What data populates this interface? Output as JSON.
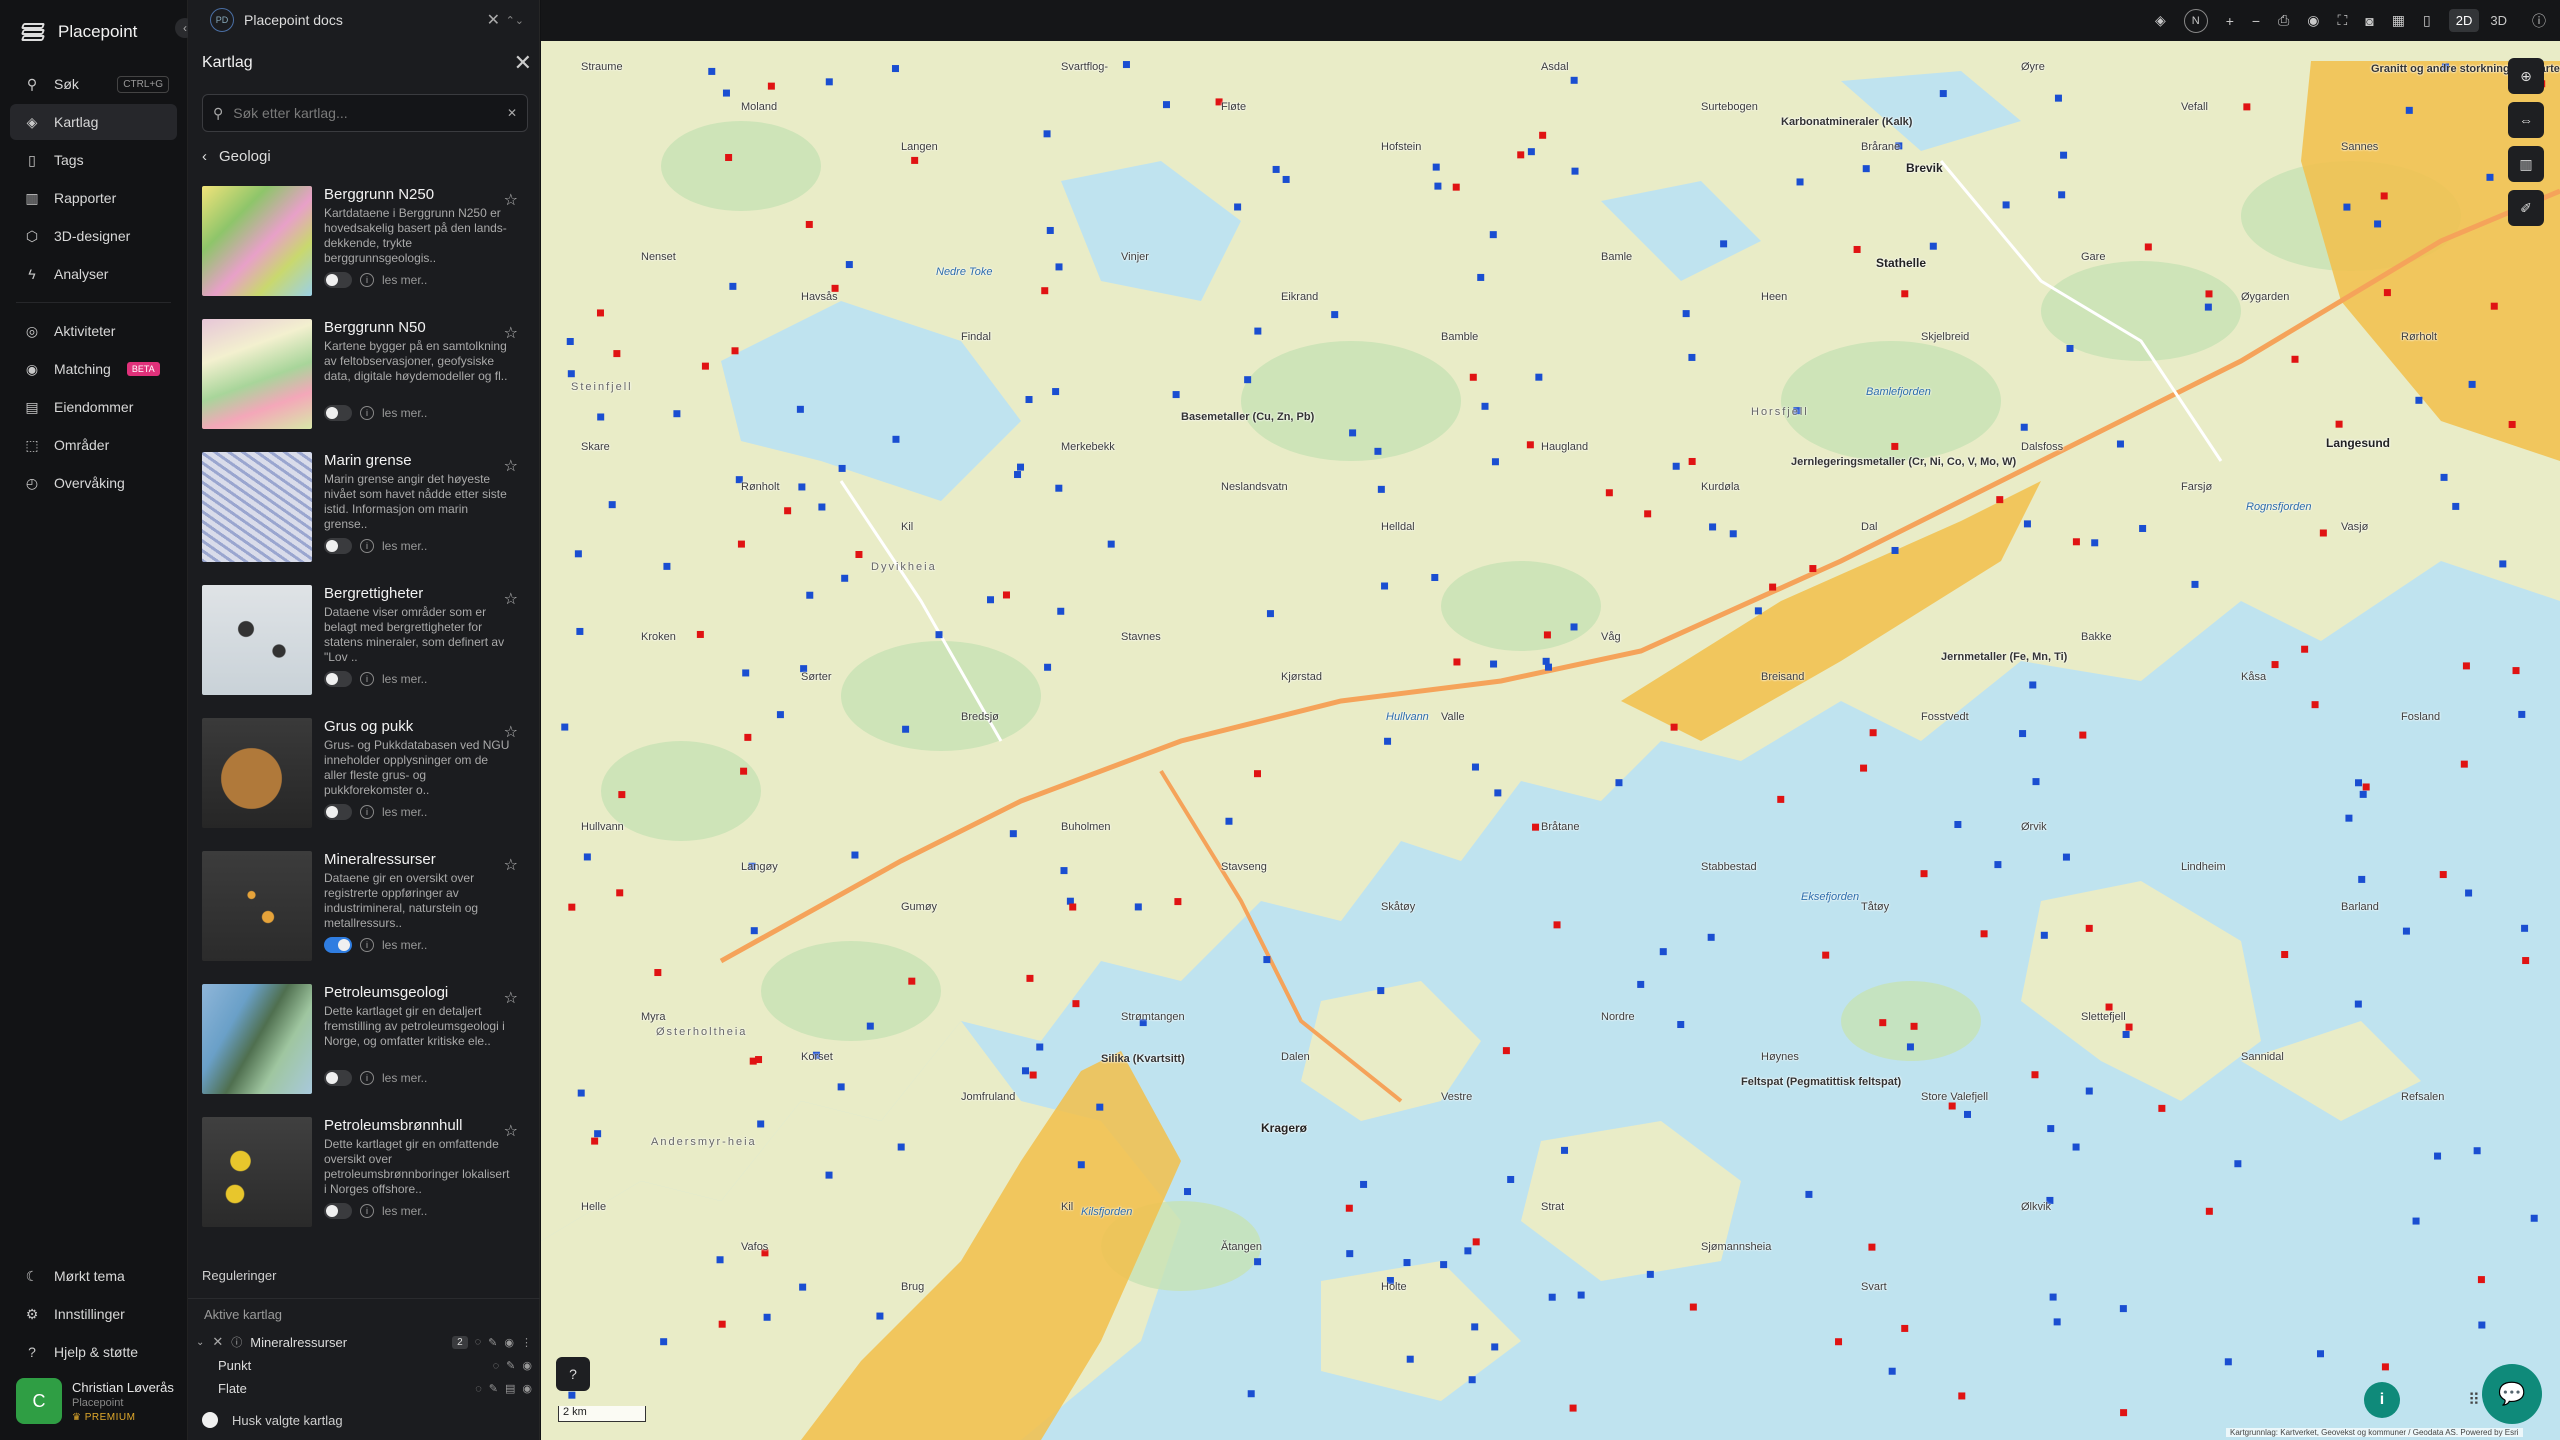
{
  "app": {
    "name": "Placepoint",
    "doc_tab": "Placepoint docs",
    "doc_initials": "PD"
  },
  "nav": {
    "items": [
      {
        "label": "Søk",
        "icon": "search-icon",
        "shortcut": "CTRL+G"
      },
      {
        "label": "Kartlag",
        "icon": "layers-icon"
      },
      {
        "label": "Tags",
        "icon": "bookmark-icon"
      },
      {
        "label": "Rapporter",
        "icon": "chart-icon"
      },
      {
        "label": "3D-designer",
        "icon": "cube-icon"
      },
      {
        "label": "Analyser",
        "icon": "bolt-icon"
      }
    ],
    "items2": [
      {
        "label": "Aktiviteter",
        "icon": "activity-icon"
      },
      {
        "label": "Matching",
        "icon": "target-icon",
        "badge": "BETA"
      },
      {
        "label": "Eiendommer",
        "icon": "table-icon"
      },
      {
        "label": "Områder",
        "icon": "area-icon"
      },
      {
        "label": "Overvåking",
        "icon": "watch-icon"
      }
    ],
    "bottom": [
      {
        "label": "Mørkt tema",
        "icon": "moon-icon"
      },
      {
        "label": "Innstillinger",
        "icon": "gear-icon"
      },
      {
        "label": "Hjelp & støtte",
        "icon": "help-icon"
      }
    ],
    "user": {
      "initial": "C",
      "name": "Christian Løverås",
      "company": "Placepoint",
      "plan": "PREMIUM"
    }
  },
  "panel": {
    "title": "Kartlag",
    "search_placeholder": "Søk etter kartlag...",
    "breadcrumb": "Geologi",
    "layers": [
      {
        "title": "Berggrunn N250",
        "desc": "Kartdataene i Berggrunn N250 er hovedsakelig basert på den lands-dekkende, trykte berggrunnsgeologis..",
        "more": "les mer..",
        "on": false
      },
      {
        "title": "Berggrunn N50",
        "desc": "Kartene bygger på en samtolkning av feltobservasjoner, geofysiske data, digitale høydemodeller og fl..",
        "more": "les mer..",
        "on": false
      },
      {
        "title": "Marin grense",
        "desc": "Marin grense angir det høyeste nivået som havet nådde etter siste istid. Informasjon om marin grense..",
        "more": "les mer..",
        "on": false
      },
      {
        "title": "Bergrettigheter",
        "desc": "Dataene viser områder som er belagt med bergrettigheter for statens mineraler, som definert av \"Lov ..",
        "more": "les mer..",
        "on": false
      },
      {
        "title": "Grus og pukk",
        "desc": "Grus- og Pukkdatabasen ved NGU inneholder opplysninger om de aller fleste grus- og pukkforekomster o..",
        "more": "les mer..",
        "on": false
      },
      {
        "title": "Mineralressurser",
        "desc": "Dataene gir en oversikt over registrerte oppføringer av industrimineral, naturstein og metallressurs..",
        "more": "les mer..",
        "on": true
      },
      {
        "title": "Petroleumsgeologi",
        "desc": "Dette kartlaget gir en detaljert fremstilling av petroleumsgeologi i Norge, og omfatter kritiske ele..",
        "more": "les mer..",
        "on": false
      },
      {
        "title": "Petroleumsbrønnhull",
        "desc": "Dette kartlaget gir en omfattende oversikt over petroleumsbrønnboringer lokalisert i Norges offshore..",
        "more": "les mer..",
        "on": false
      }
    ],
    "regulations": "Reguleringer",
    "active_title": "Aktive kartlag",
    "active_layer": {
      "name": "Mineralressurser",
      "count": "2",
      "sub": [
        "Punkt",
        "Flate"
      ]
    },
    "remember": "Husk valgte kartlag"
  },
  "topbar": {
    "compass": "N",
    "mode_2d": "2D",
    "mode_3d": "3D"
  },
  "map": {
    "scale": "2 km",
    "attribution": "Kartgrunnlag: Kartverket, Geovekst og kommuner / Geodata AS. Powered by Esri",
    "labels": {
      "towns": [
        "Kragerø",
        "Stathelle",
        "Brevik",
        "Langesund"
      ],
      "places": [
        "Straume",
        "Moland",
        "Langen",
        "Svartflog-",
        "Fløte",
        "Hofstein",
        "Asdal",
        "Surtebogen",
        "Brårane",
        "Øyre",
        "Vefall",
        "Sannes",
        "Nenset",
        "Havsås",
        "Findal",
        "Vinjer",
        "Eikrand",
        "Bamble",
        "Bamle",
        "Heen",
        "Skjelbreid",
        "Gare",
        "Øygarden",
        "Rørholt",
        "Skare",
        "Rønholt",
        "Kil",
        "Merkebekk",
        "Neslandsvatn",
        "Helldal",
        "Haugland",
        "Kurdøla",
        "Dal",
        "Dalsfoss",
        "Farsjø",
        "Vasjø",
        "Kroken",
        "Sørter",
        "Bredsjø",
        "Stavnes",
        "Kjørstad",
        "Valle",
        "Våg",
        "Breisand",
        "Fosstvedt",
        "Bakke",
        "Kåsa",
        "Fosland",
        "Hullvann",
        "Langøy",
        "Gumøy",
        "Buholmen",
        "Stavseng",
        "Skåtøy",
        "Bråtane",
        "Stabbestad",
        "Tåtøy",
        "Ørvik",
        "Lindheim",
        "Barland",
        "Myra",
        "Korset",
        "Jomfruland",
        "Strømtangen",
        "Dalen",
        "Vestre",
        "Nordre",
        "Høynes",
        "Store Valefjell",
        "Slettefjell",
        "Sannidal",
        "Refsalen",
        "Helle",
        "Vafos",
        "Brug",
        "Kil",
        "Ătangen",
        "Holte",
        "Strat",
        "Sjømannsheia",
        "Svart",
        "Ølkvik"
      ],
      "water": [
        "Nedre Toke",
        "Bamlefjorden",
        "Rognsfjorden",
        "Kilsfjorden",
        "Eksefjorden",
        "Hullvann"
      ],
      "areas": [
        "Dyvikheia",
        "Østerholtheia",
        "Andersmyr-heia",
        "Horsfjell",
        "Steinfjell"
      ],
      "minerals": [
        "Granitt og andre storkningsbergarter (Larvikitt)",
        "Karbonatmineraler (Kalk)",
        "Basemetaller (Cu, Zn, Pb)",
        "Jernlegeringsmetaller (Cr, Ni, Co, V, Mo, W)",
        "Jernmetaller (Fe, Mn, Ti)",
        "Silika (Kvartsitt)",
        "Feltspat (Pegmatittisk feltspat)"
      ]
    },
    "colors": {
      "land": "#e9ecc7",
      "forest": "#c7e2b4",
      "water": "#bfe3ef",
      "mineral_area": "#f2c04a",
      "point_blue": "#1a4ed1",
      "point_red": "#e01313",
      "road": "#f5a35a"
    }
  }
}
